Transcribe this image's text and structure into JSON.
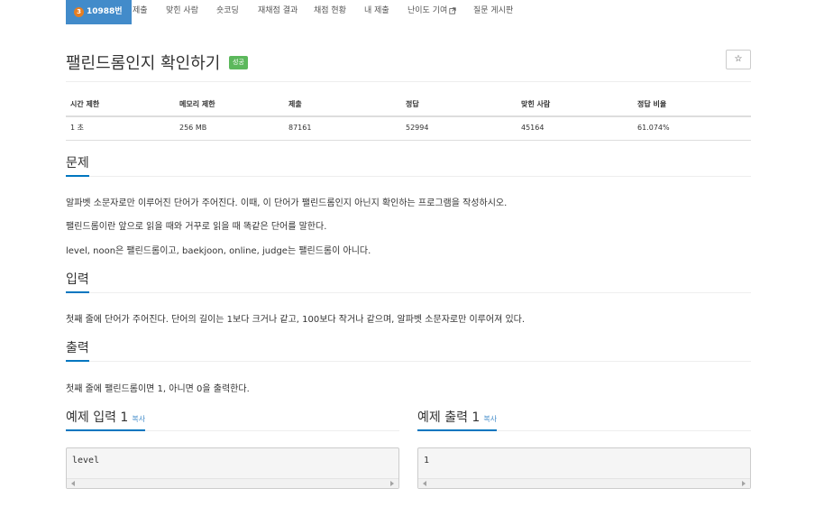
{
  "nav": {
    "problem_badge": "3",
    "problem_number": "10988번",
    "items": [
      "제출",
      "맞힌 사람",
      "숏코딩",
      "재채점 결과",
      "채점 현황",
      "내 제출",
      "난이도 기여",
      "질문 게시판"
    ]
  },
  "title": "팰린드롬인지 확인하기",
  "status_label": "성공",
  "star_icon": "☆",
  "info": {
    "headers": [
      "시간 제한",
      "메모리 제한",
      "제출",
      "정답",
      "맞힌 사람",
      "정답 비율"
    ],
    "values": [
      "1 초",
      "256 MB",
      "87161",
      "52994",
      "45164",
      "61.074%"
    ]
  },
  "sections": {
    "problem_heading": "문제",
    "problem_lines": [
      "알파벳 소문자로만 이루어진 단어가 주어진다. 이때, 이 단어가 팰린드롬인지 아닌지 확인하는 프로그램을 작성하시오.",
      "팰린드롬이란 앞으로 읽을 때와 거꾸로 읽을 때 똑같은 단어를 말한다.",
      "level, noon은 팰린드롬이고, baekjoon, online, judge는 팰린드롬이 아니다."
    ],
    "input_heading": "입력",
    "input_text": "첫째 줄에 단어가 주어진다. 단어의 길이는 1보다 크거나 같고, 100보다 작거나 같으며, 알파벳 소문자로만 이루어져 있다.",
    "output_heading": "출력",
    "output_text": "첫째 줄에 팰린드롬이면 1, 아니면 0을 출력한다."
  },
  "samples": {
    "input_heading": "예제 입력 1",
    "output_heading": "예제 출력 1",
    "copy_label": "복사",
    "input_value": "level",
    "output_value": "1"
  },
  "colors": {
    "nav_active": "#428bca",
    "success": "#5cb85c",
    "link": "#428bca",
    "heading_underline": "#0076c0"
  }
}
